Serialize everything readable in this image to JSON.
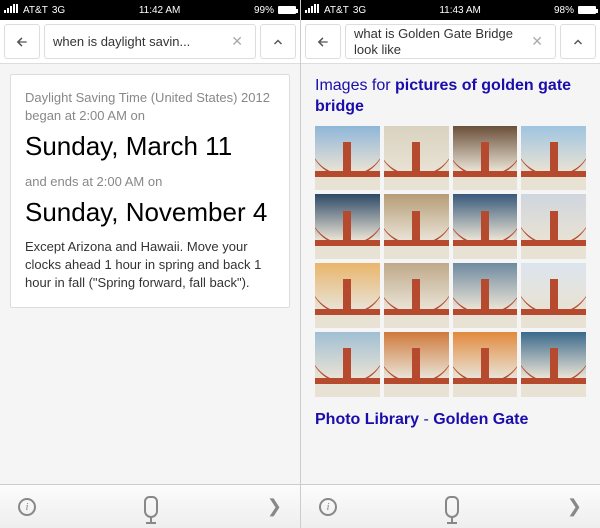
{
  "left": {
    "status": {
      "carrier": "AT&T",
      "signal_icon": "3G",
      "time": "11:42 AM",
      "battery_pct": "99%"
    },
    "search": {
      "query": "when is daylight savin..."
    },
    "card": {
      "lead": "Daylight Saving Time (United States) 2012 began at 2:00 AM on",
      "start_date": "Sunday, March 11",
      "mid": "and ends at 2:00 AM on",
      "end_date": "Sunday, November 4",
      "note": "Except Arizona and Hawaii. Move your clocks ahead 1 hour in spring and back 1 hour in fall (\"Spring forward, fall back\")."
    }
  },
  "right": {
    "status": {
      "carrier": "AT&T",
      "signal_icon": "3G",
      "time": "11:43 AM",
      "battery_pct": "98%"
    },
    "search": {
      "query": "what is Golden Gate Bridge look like"
    },
    "images_header_prefix": "Images for ",
    "images_header_bold": "pictures of golden gate bridge",
    "thumbs": [
      {
        "sky": "#8fb6d9"
      },
      {
        "sky": "#d9d2c0"
      },
      {
        "sky": "#6b4f3a"
      },
      {
        "sky": "#9fc4e0"
      },
      {
        "sky": "#2d4966"
      },
      {
        "sky": "#b59c77"
      },
      {
        "sky": "#38597a"
      },
      {
        "sky": "#cfd6de"
      },
      {
        "sky": "#e9b56b"
      },
      {
        "sky": "#bfa98a"
      },
      {
        "sky": "#6e8aa0"
      },
      {
        "sky": "#dce5ee"
      },
      {
        "sky": "#a0bfd4"
      },
      {
        "sky": "#cf7a3b"
      },
      {
        "sky": "#e28a3e"
      },
      {
        "sky": "#3b6a8c"
      }
    ],
    "bottom_link_prefix": "Photo Library",
    "bottom_link_sep": " - ",
    "bottom_link_accent": "Golden Gate"
  }
}
